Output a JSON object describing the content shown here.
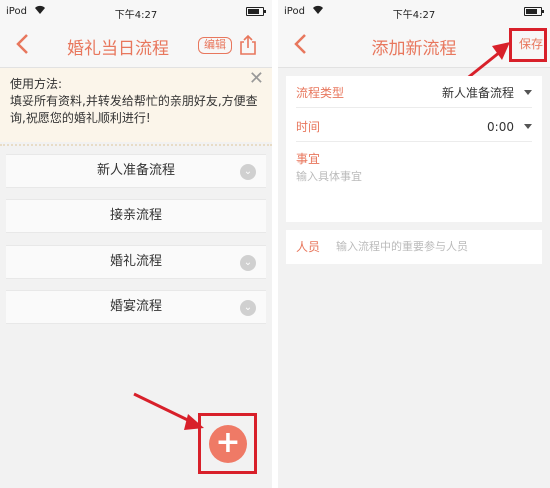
{
  "left": {
    "status": {
      "carrier": "iPod",
      "time": "下午4:27"
    },
    "nav": {
      "title": "婚礼当日流程",
      "edit_label": "编辑"
    },
    "notice": {
      "title": "使用方法:",
      "body": "填妥所有资料,并转发给帮忙的亲朋好友,方便查询,祝愿您的婚礼顺利进行!"
    },
    "items": [
      {
        "label": "新人准备流程"
      },
      {
        "label": "接亲流程"
      },
      {
        "label": "婚礼流程"
      },
      {
        "label": "婚宴流程"
      }
    ],
    "add_label": "+"
  },
  "right": {
    "status": {
      "carrier": "iPod",
      "time": "下午4:27"
    },
    "nav": {
      "title": "添加新流程",
      "save_label": "保存"
    },
    "form": {
      "type_label": "流程类型",
      "type_value": "新人准备流程",
      "time_label": "时间",
      "time_value": "0:00",
      "matter_label": "事宜",
      "matter_placeholder": "输入具体事宜",
      "people_label": "人员",
      "people_placeholder": "输入流程中的重要参与人员"
    }
  },
  "colors": {
    "accent": "#e8775d",
    "highlight": "#d8202a",
    "add_button": "#ef7a66"
  },
  "status_battery_level": 0.7
}
